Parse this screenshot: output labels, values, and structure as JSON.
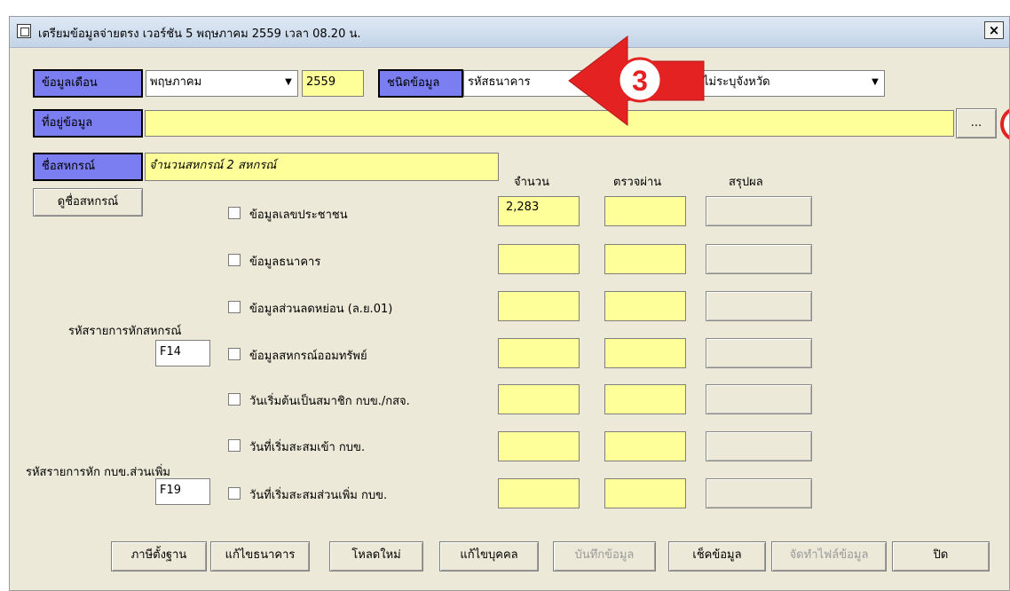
{
  "window": {
    "title": "เตรียมข้อมูลจ่ายตรง เวอร์ชัน 5 พฤษภาคม 2559 เวลา 08.20 น.",
    "close_label": "×"
  },
  "top": {
    "month_label": "ข้อมูลเดือน",
    "month_value": "พฤษภาคม",
    "year_value": "2559",
    "type_label": "ชนิดข้อมูล",
    "type_value": "รหัสธนาคาร",
    "province_value": "ไม่ระบุจังหวัด",
    "location_label": "ที่อยู่ข้อมูล",
    "location_value": "",
    "browse_label": "...",
    "coop_label": "ชื่อสหกรณ์",
    "coop_value": "จำนวนสหกรณ์ 2 สหกรณ์",
    "view_coop_label": "ดูชื่อสหกรณ์"
  },
  "annotation": {
    "badge_number": "3",
    "arrow_color": "#e42222"
  },
  "columns": {
    "count": "จำนวน",
    "passed": "ตรวจผ่าน",
    "summary": "สรุปผล"
  },
  "rows": [
    {
      "label": "ข้อมูลเลขประชาชน",
      "count": "2,283",
      "passed": "",
      "checked": false
    },
    {
      "label": "ข้อมูลธนาคาร",
      "count": "",
      "passed": "",
      "checked": false
    },
    {
      "label": "ข้อมูลส่วนลดหย่อน (ล.ย.01)",
      "count": "",
      "passed": "",
      "checked": false
    },
    {
      "label": "ข้อมูลสหกรณ์ออมทรัพย์",
      "count": "",
      "passed": "",
      "checked": false
    },
    {
      "label": "วันเริ่มต้นเป็นสมาชิก กบข./กสจ.",
      "count": "",
      "passed": "",
      "checked": false
    },
    {
      "label": "วันที่เริ่มสะสมเข้า กบข.",
      "count": "",
      "passed": "",
      "checked": false
    },
    {
      "label": "วันที่เริ่มสะสมส่วนเพิ่ม กบข.",
      "count": "",
      "passed": "",
      "checked": false
    }
  ],
  "codes": {
    "coop_deduct_label": "รหัสรายการหักสหกรณ์",
    "coop_deduct_value": "F14",
    "gpf_extra_label": "รหัสรายการหัก กบข.ส่วนเพิ่ม",
    "gpf_extra_value": "F19"
  },
  "buttons": [
    {
      "label": "ภาษีตั้งฐาน",
      "enabled": true
    },
    {
      "label": "แก้ไขธนาคาร",
      "enabled": true
    },
    {
      "label": "โหลดใหม่",
      "enabled": true
    },
    {
      "label": "แก้ไขบุคคล",
      "enabled": true
    },
    {
      "label": "บันทึกข้อมูล",
      "enabled": false
    },
    {
      "label": "เช็คข้อมูล",
      "enabled": true
    },
    {
      "label": "จัดทำไฟล์ข้อมูล",
      "enabled": false
    },
    {
      "label": "ปิด",
      "enabled": true
    }
  ],
  "colors": {
    "label_blue": "#7b7ef0",
    "field_yellow": "#ffff99",
    "window_bg": "#ece9d8"
  }
}
